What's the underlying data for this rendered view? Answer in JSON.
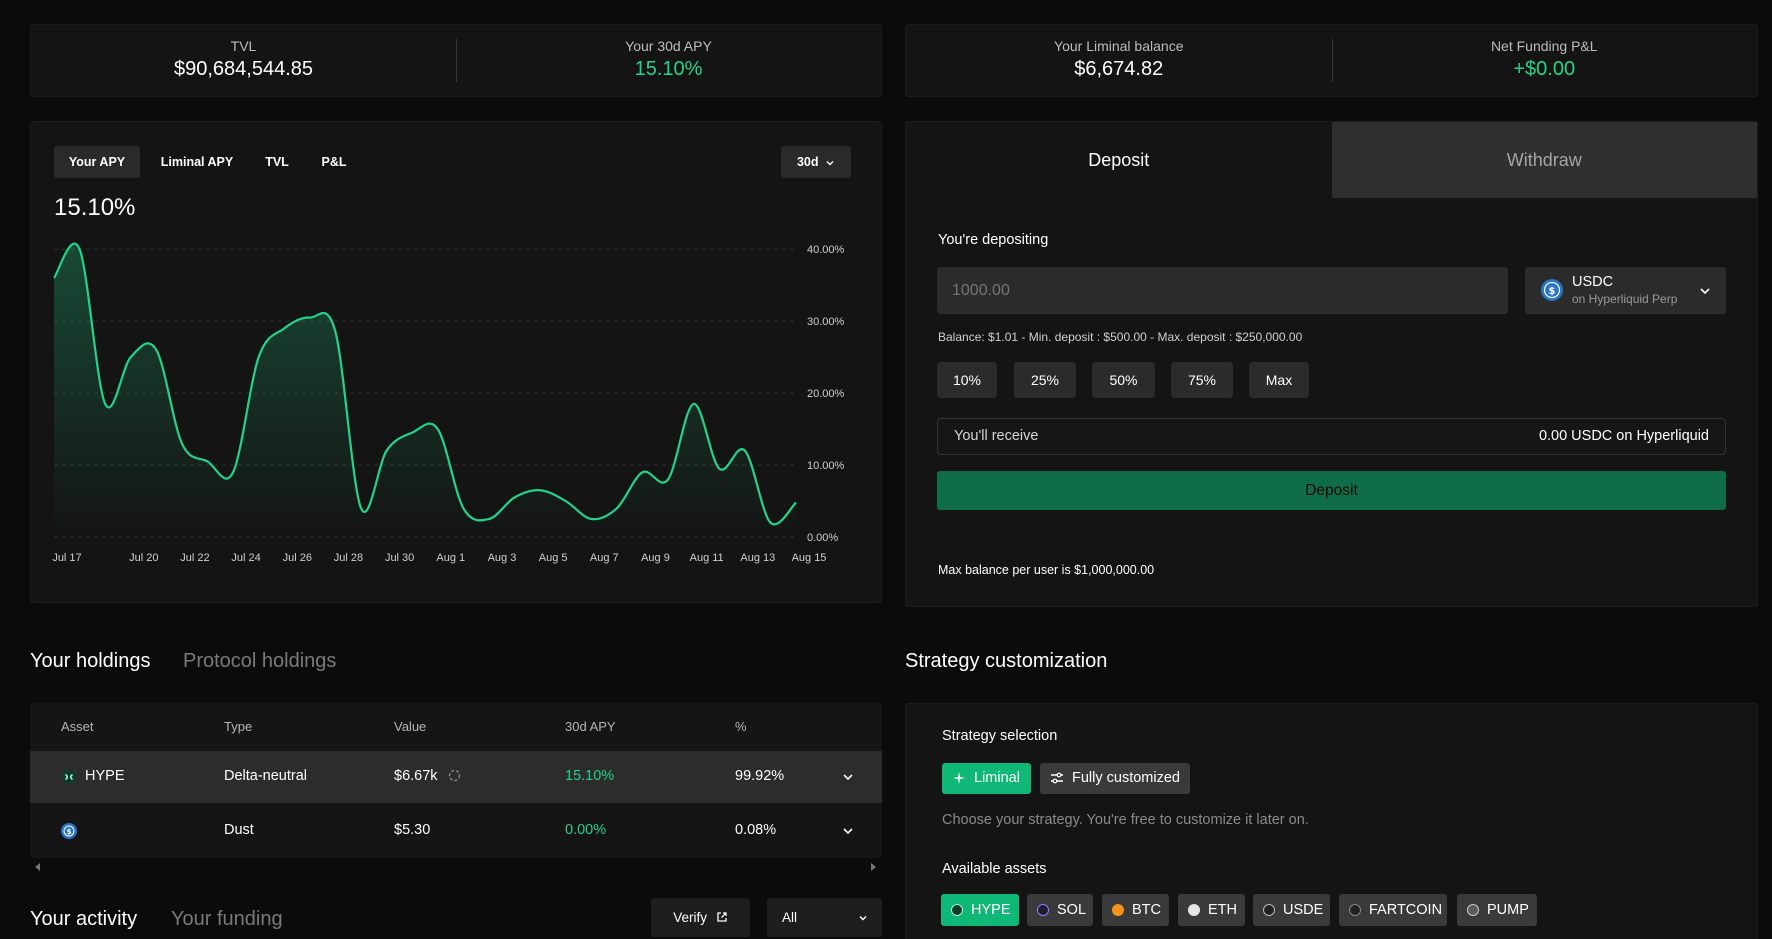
{
  "stats_left": {
    "tvl": {
      "label": "TVL",
      "value": "$90,684,544.85"
    },
    "apy": {
      "label": "Your 30d APY",
      "value": "15.10%"
    }
  },
  "stats_right": {
    "balance": {
      "label": "Your Liminal balance",
      "value": "$6,674.82"
    },
    "pnl": {
      "label": "Net Funding P&L",
      "value": "+$0.00"
    }
  },
  "chart_tabs": [
    "Your APY",
    "Liminal APY",
    "TVL",
    "P&L"
  ],
  "chart_range": "30d",
  "chart_headline": "15.10%",
  "chart_data": {
    "type": "area",
    "title": "",
    "x": [
      "Jul 17",
      "Jul 18",
      "Jul 19",
      "Jul 20",
      "Jul 21",
      "Jul 22",
      "Jul 23",
      "Jul 24",
      "Jul 25",
      "Jul 26",
      "Jul 27",
      "Jul 28",
      "Jul 29",
      "Jul 30",
      "Jul 31",
      "Aug 1",
      "Aug 2",
      "Aug 3",
      "Aug 4",
      "Aug 5",
      "Aug 6",
      "Aug 7",
      "Aug 8",
      "Aug 9",
      "Aug 10",
      "Aug 11",
      "Aug 12",
      "Aug 13",
      "Aug 14",
      "Aug 15"
    ],
    "series": [
      {
        "values": [
          36.0,
          40.0,
          18.5,
          25.0,
          26.0,
          13.0,
          10.5,
          9.0,
          25.0,
          29.0,
          30.5,
          28.5,
          4.0,
          12.0,
          14.5,
          15.0,
          4.0,
          2.5,
          5.5,
          6.5,
          5.0,
          2.5,
          4.0,
          9.0,
          8.0,
          18.5,
          9.5,
          12.0,
          2.0,
          4.8
        ]
      }
    ],
    "x_tick_labels": [
      "Jul 17",
      "Jul 20",
      "Jul 22",
      "Jul 24",
      "Jul 26",
      "Jul 28",
      "Jul 30",
      "Aug 1",
      "Aug 3",
      "Aug 5",
      "Aug 7",
      "Aug 9",
      "Aug 11",
      "Aug 13",
      "Aug 15"
    ],
    "y_ticks": [
      "40.00%",
      "30.00%",
      "20.00%",
      "10.00%",
      "0.00%"
    ],
    "y_tick_values": [
      40,
      30,
      20,
      10,
      0
    ],
    "ylim": [
      0,
      41
    ],
    "y_axis_side": "right",
    "grid": true,
    "color": "#22d38a"
  },
  "deposit": {
    "tab_deposit": "Deposit",
    "tab_withdraw": "Withdraw",
    "label": "You're depositing",
    "placeholder": "1000.00",
    "token": "USDC",
    "token_sub": "on Hyperliquid Perp",
    "limits": "Balance: $1.01 - Min. deposit : $500.00 - Max. deposit : $250,000.00",
    "pct": [
      "10%",
      "25%",
      "50%",
      "75%",
      "Max"
    ],
    "receive_label": "You'll receive",
    "receive_value": "0.00 USDC on Hyperliquid",
    "button": "Deposit",
    "max_note": "Max balance per user is $1,000,000.00"
  },
  "holdings": {
    "tab_active": "Your holdings",
    "tab_other": "Protocol holdings",
    "headers": [
      "Asset",
      "Type",
      "Value",
      "30d APY",
      "%"
    ],
    "rows": [
      {
        "asset": "HYPE",
        "type": "Delta-neutral",
        "value": "$6.67k",
        "apy": "15.10%",
        "pct": "99.92%"
      },
      {
        "asset": "",
        "type": "Dust",
        "value": "$5.30",
        "apy": "0.00%",
        "pct": "0.08%"
      }
    ]
  },
  "activity": {
    "tab_active": "Your activity",
    "tab_other": "Your funding",
    "verify": "Verify",
    "filter": "All"
  },
  "strategy": {
    "title": "Strategy customization",
    "selection_label": "Strategy selection",
    "options": [
      "Liminal",
      "Fully customized"
    ],
    "hint": "Choose your strategy. You're free to customize it later on.",
    "assets_label": "Available assets",
    "assets": [
      "HYPE",
      "SOL",
      "BTC",
      "ETH",
      "USDE",
      "FARTCOIN",
      "PUMP"
    ]
  },
  "colors": {
    "accent": "#22d38a",
    "deposit_button": "#0e6c47",
    "background": "#0b0b0b",
    "panel": "#141414"
  }
}
